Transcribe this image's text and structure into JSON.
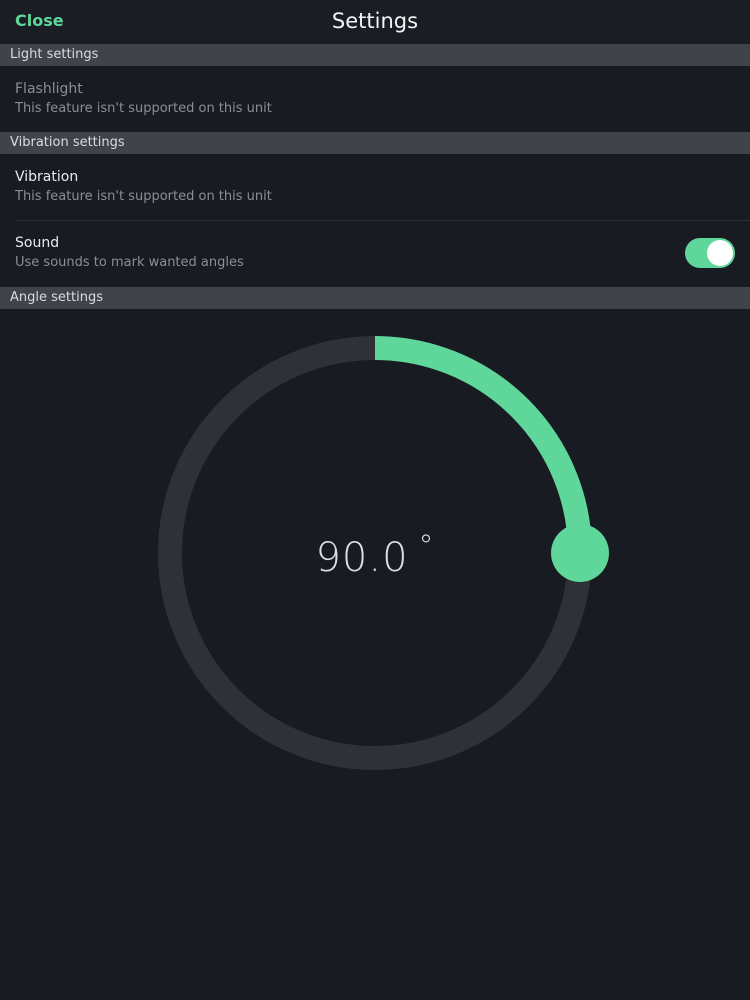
{
  "header": {
    "close_label": "Close",
    "title": "Settings"
  },
  "sections": {
    "light": {
      "header": "Light settings",
      "flashlight": {
        "title": "Flashlight",
        "subtitle": "This feature isn't supported on this unit"
      }
    },
    "vibration": {
      "header": "Vibration settings",
      "vibration": {
        "title": "Vibration",
        "subtitle": "This feature isn't supported on this unit"
      },
      "sound": {
        "title": "Sound",
        "subtitle": "Use sounds to mark wanted angles",
        "enabled": true
      }
    },
    "angle": {
      "header": "Angle settings",
      "value": "90.0",
      "unit": "°",
      "angle_degrees": 90
    }
  },
  "colors": {
    "accent": "#5fd69a",
    "background": "#181b22",
    "section_header": "#40434a",
    "track": "#2f3137"
  }
}
